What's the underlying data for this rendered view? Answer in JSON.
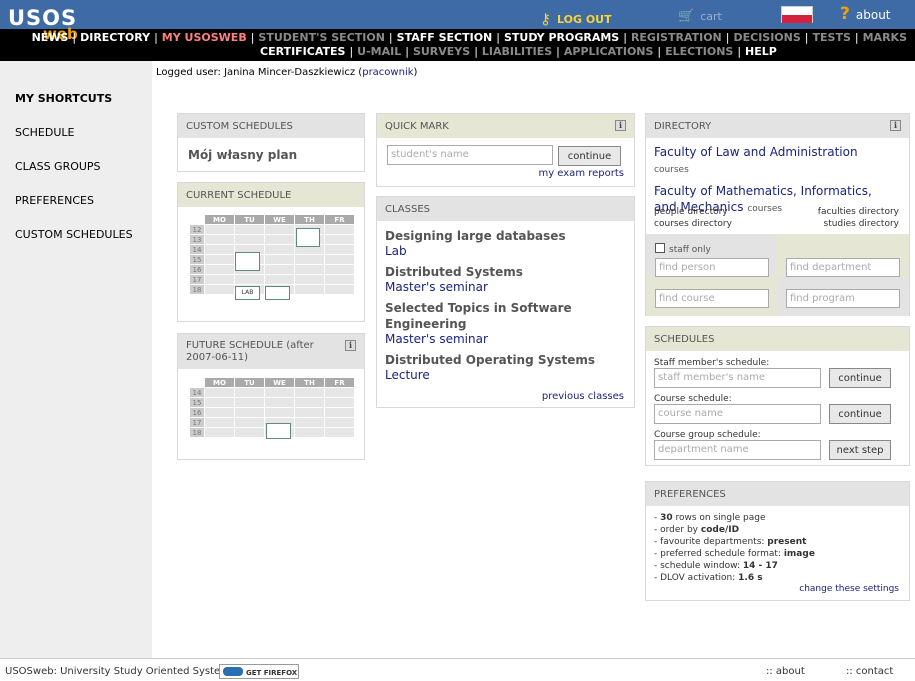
{
  "header": {
    "logo_main": "USOS",
    "logo_sub": "web",
    "logout": "LOG OUT",
    "cart": "cart",
    "about": "about",
    "colors": {
      "top_bar": "#3e6aa6",
      "menu_bar": "#000000",
      "active_menu": "#ff8080",
      "logo_accent": "#f5a200"
    }
  },
  "menu": {
    "row1": [
      {
        "label": "NEWS",
        "state": "normal"
      },
      {
        "label": "DIRECTORY",
        "state": "normal"
      },
      {
        "label": "MY USOSWEB",
        "state": "active"
      },
      {
        "label": "STUDENT'S SECTION",
        "state": "disabled"
      },
      {
        "label": "STAFF SECTION",
        "state": "normal"
      },
      {
        "label": "STUDY PROGRAMS",
        "state": "normal"
      },
      {
        "label": "REGISTRATION",
        "state": "disabled"
      },
      {
        "label": "DECISIONS",
        "state": "disabled"
      },
      {
        "label": "TESTS",
        "state": "disabled"
      },
      {
        "label": "MARKS",
        "state": "disabled"
      }
    ],
    "row2": [
      {
        "label": "CERTIFICATES",
        "state": "normal"
      },
      {
        "label": "U-MAIL",
        "state": "disabled"
      },
      {
        "label": "SURVEYS",
        "state": "disabled"
      },
      {
        "label": "LIABILITIES",
        "state": "disabled"
      },
      {
        "label": "APPLICATIONS",
        "state": "disabled"
      },
      {
        "label": "ELECTIONS",
        "state": "disabled"
      },
      {
        "label": "HELP",
        "state": "normal"
      }
    ]
  },
  "sidebar": {
    "items": [
      "MY SHORTCUTS",
      "SCHEDULE",
      "CLASS GROUPS",
      "PREFERENCES",
      "CUSTOM SCHEDULES"
    ]
  },
  "user": {
    "prefix": "Logged user:",
    "name": "Janina Mincer-Daszkiewicz",
    "role": "pracownik"
  },
  "custom_schedules": {
    "title": "CUSTOM SCHEDULES",
    "plan": "Mój własny plan"
  },
  "current_schedule": {
    "title": "CURRENT SCHEDULE",
    "days": [
      "MO",
      "TU",
      "WE",
      "TH",
      "FR"
    ],
    "hours": [
      "12",
      "13",
      "14",
      "15",
      "16",
      "17",
      "18"
    ],
    "lab_label": "LAB"
  },
  "future_schedule": {
    "title": "FUTURE SCHEDULE (after 2007-06-11)",
    "days": [
      "MO",
      "TU",
      "WE",
      "TH",
      "FR"
    ],
    "hours": [
      "14",
      "15",
      "16",
      "17",
      "18"
    ]
  },
  "quick_mark": {
    "title": "QUICK MARK",
    "placeholder": "student's name",
    "button": "continue",
    "link": "my exam reports"
  },
  "classes": {
    "title": "CLASSES",
    "items": [
      {
        "name": "Designing large databases",
        "type": "Lab"
      },
      {
        "name": "Distributed Systems",
        "type": "Master's seminar"
      },
      {
        "name": "Selected Topics in Software Engineering",
        "type": "Master's seminar"
      },
      {
        "name": "Distributed Operating Systems",
        "type": "Lecture"
      }
    ],
    "previous": "previous classes"
  },
  "directory": {
    "title": "DIRECTORY",
    "faculties": [
      {
        "name": "Faculty of Law and Administration",
        "suffix": "courses"
      },
      {
        "name": "Faculty of Mathematics, Informatics, and Mechanics",
        "suffix": "courses"
      }
    ],
    "people_dir": "people directory",
    "courses_dir": "courses directory",
    "faculties_dir": "faculties directory",
    "studies_dir": "studies directory",
    "staff_only": "staff only",
    "find_person": "find person",
    "find_department": "find department",
    "find_course": "find course",
    "find_program": "find program"
  },
  "schedules": {
    "title": "SCHEDULES",
    "staff_label": "Staff member's schedule:",
    "staff_placeholder": "staff member's name",
    "course_label": "Course schedule:",
    "course_placeholder": "course name",
    "group_label": "Course group schedule:",
    "group_placeholder": "department name",
    "continue": "continue",
    "next_step": "next step"
  },
  "preferences": {
    "title": "PREFERENCES",
    "lines": [
      {
        "prefix": "- ",
        "bold": "30",
        "rest": " rows on single page"
      },
      {
        "prefix": "- order by ",
        "bold": "code/ID",
        "rest": ""
      },
      {
        "prefix": "- favourite departments: ",
        "bold": "present",
        "rest": ""
      },
      {
        "prefix": "- preferred schedule format: ",
        "bold": "image",
        "rest": ""
      },
      {
        "prefix": "- schedule window: ",
        "bold": "14 - 17",
        "rest": ""
      },
      {
        "prefix": "- DLOV activation: ",
        "bold": "1.6 s",
        "rest": ""
      }
    ],
    "change": "change these settings"
  },
  "footer": {
    "system": "USOSweb: University Study Oriented System",
    "firefox": "GET FIREFOX",
    "about": "about",
    "contact": "contact"
  }
}
